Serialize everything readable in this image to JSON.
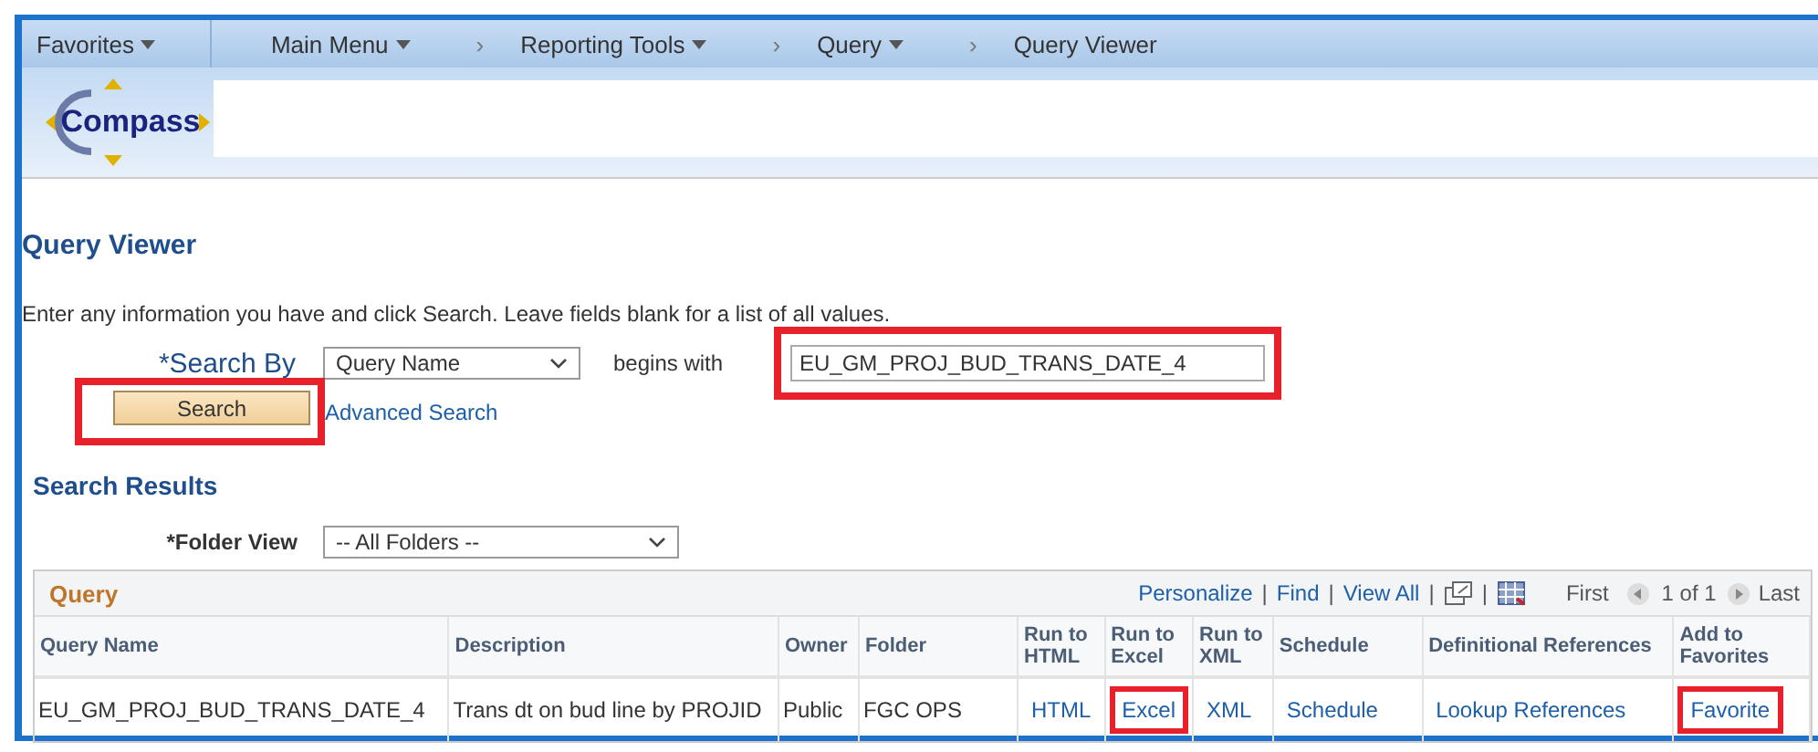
{
  "nav": [
    {
      "label": "Favorites",
      "menu": true
    },
    {
      "label": "Main Menu",
      "menu": true
    },
    {
      "label": "Reporting Tools",
      "menu": true,
      "separator": "›"
    },
    {
      "label": "Query",
      "menu": true,
      "separator": "›"
    },
    {
      "label": "Query Viewer",
      "menu": false,
      "separator": "›"
    }
  ],
  "logo": {
    "text": "Compass"
  },
  "page": {
    "title": "Query Viewer",
    "instructions": "Enter any information you have and click Search. Leave fields blank for a list of all values."
  },
  "search": {
    "label": "*Search By",
    "select": "Query Name",
    "operator": "begins with",
    "value": "EU_GM_PROJ_BUD_TRANS_DATE_4",
    "value_highlighted": true,
    "button": "Search",
    "button_highlighted": true,
    "advanced": "Advanced Search"
  },
  "results": {
    "title": "Search Results",
    "folder_label": "*Folder View",
    "folder": "-- All Folders --"
  },
  "grid": {
    "title": "Query",
    "toolbar": [
      {
        "kind": "link",
        "text": "Personalize"
      },
      {
        "kind": "separator",
        "text": "|"
      },
      {
        "kind": "link",
        "text": "Find"
      },
      {
        "kind": "separator",
        "text": "|"
      },
      {
        "kind": "link",
        "text": "View All"
      },
      {
        "kind": "separator",
        "text": "|"
      },
      {
        "kind": "window"
      },
      {
        "kind": "separator",
        "text": "|"
      },
      {
        "kind": "spreadsheet"
      }
    ],
    "first": "First",
    "count": "1 of 1",
    "last": "Last",
    "columns": [
      "Query Name",
      "Description",
      "Owner",
      "Folder",
      "Run to HTML",
      "Run to Excel",
      "Run to XML",
      "Schedule",
      "Definitional References",
      "Add to Favorites"
    ],
    "rows": [
      {
        "cells": [
          {
            "text": "EU_GM_PROJ_BUD_TRANS_DATE_4",
            "kind": "text"
          },
          {
            "text": "Trans dt on bud line by PROJID",
            "kind": "text"
          },
          {
            "text": "Public",
            "kind": "text"
          },
          {
            "text": "FGC OPS",
            "kind": "text"
          },
          {
            "text": "HTML",
            "kind": "link",
            "highlighted": false
          },
          {
            "text": "Excel",
            "kind": "link",
            "highlighted": true
          },
          {
            "text": "XML",
            "kind": "link",
            "highlighted": false
          },
          {
            "text": "Schedule",
            "kind": "link",
            "highlighted": false
          },
          {
            "text": "Lookup References",
            "kind": "link",
            "highlighted": false
          },
          {
            "text": "Favorite",
            "kind": "link",
            "highlighted": true
          }
        ]
      }
    ]
  }
}
